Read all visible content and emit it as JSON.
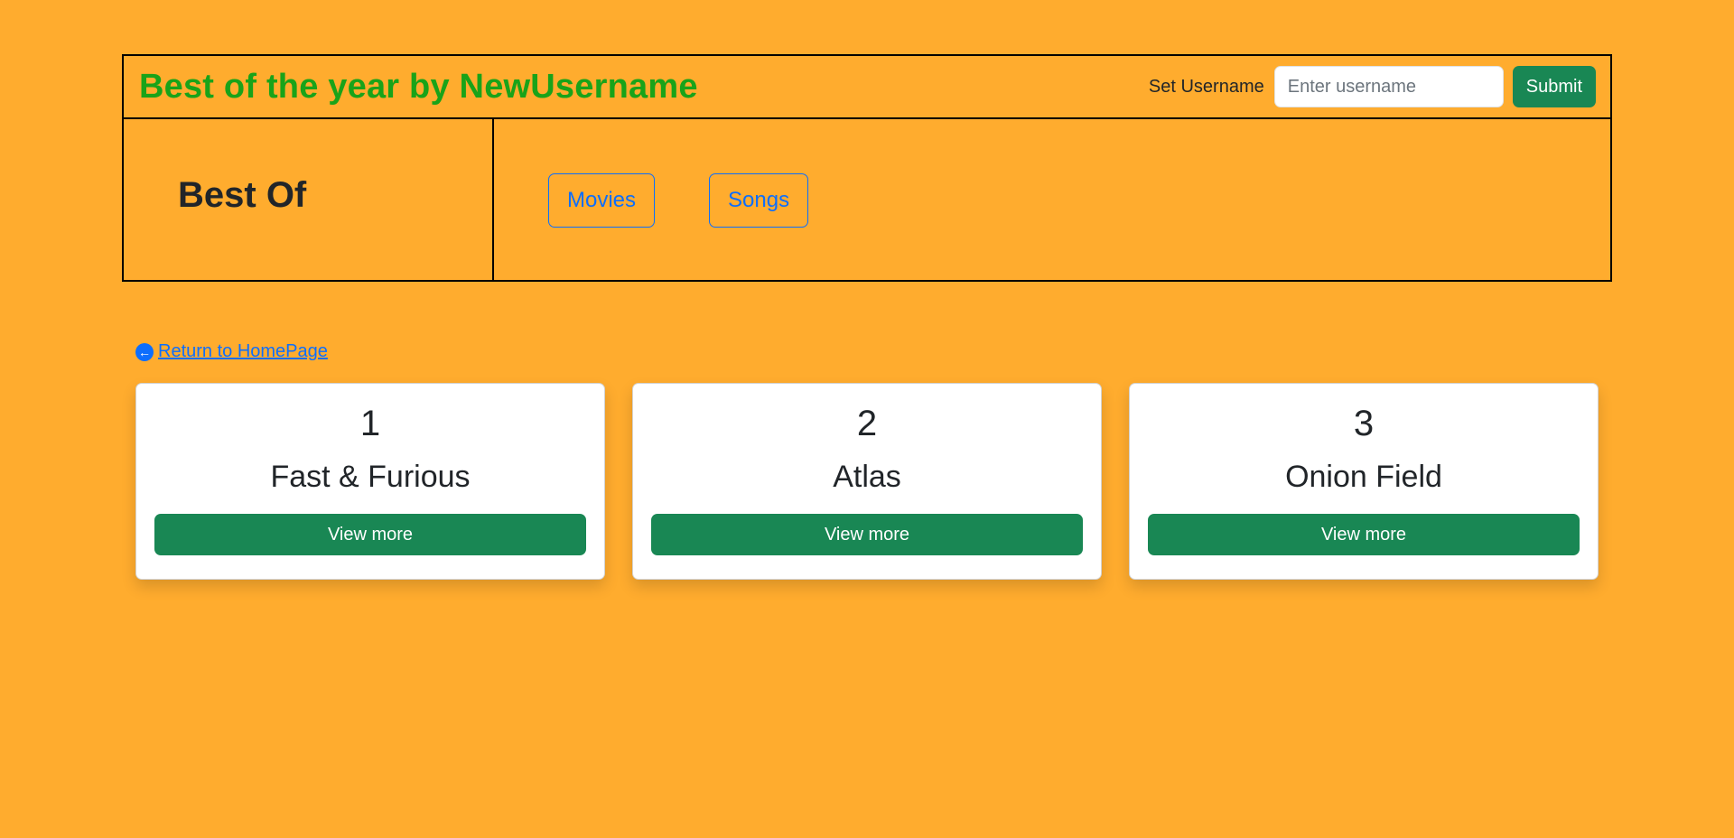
{
  "header": {
    "title": "Best of the year by NewUsername",
    "username_label": "Set Username",
    "username_placeholder": "Enter username",
    "username_value": "",
    "submit_label": "Submit"
  },
  "nav": {
    "brand": "Best Of",
    "links": [
      {
        "label": "Movies"
      },
      {
        "label": "Songs"
      }
    ]
  },
  "return_link": {
    "icon": "arrow-left-circle-icon",
    "label": "Return to HomePage"
  },
  "cards": [
    {
      "rank": "1",
      "title": "Fast & Furious",
      "button_label": "View more"
    },
    {
      "rank": "2",
      "title": "Atlas",
      "button_label": "View more"
    },
    {
      "rank": "3",
      "title": "Onion Field",
      "button_label": "View more"
    }
  ],
  "colors": {
    "background": "#ffac2e",
    "title_green": "#19a319",
    "button_green": "#198754",
    "link_blue": "#0d6efd"
  }
}
